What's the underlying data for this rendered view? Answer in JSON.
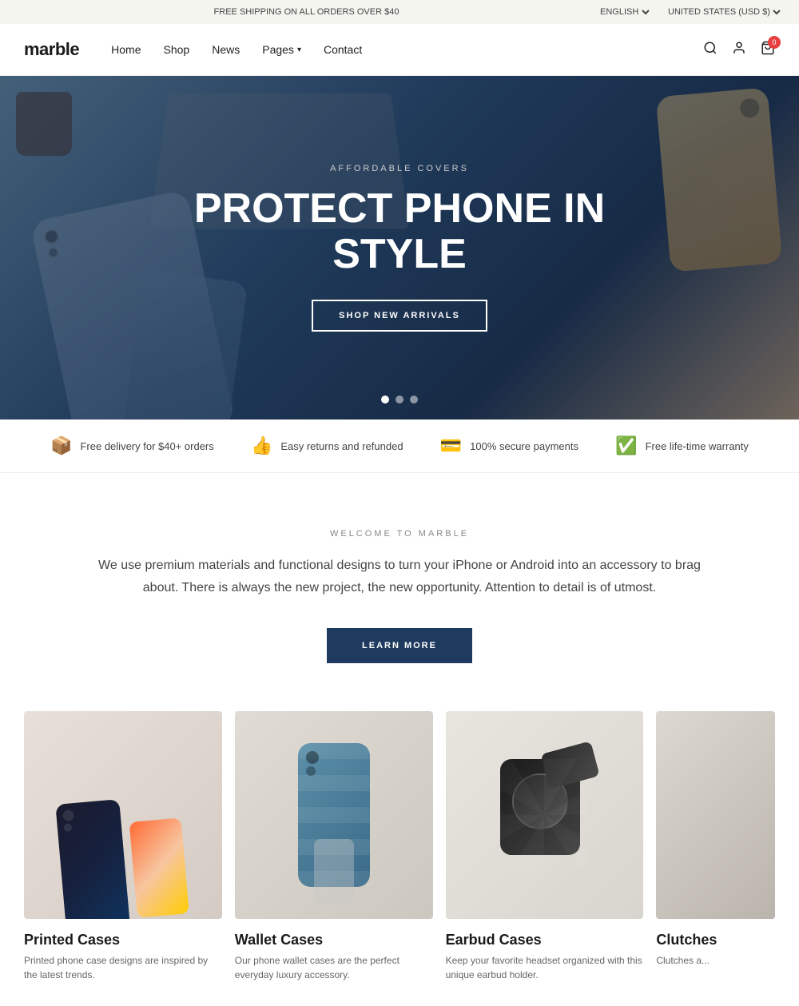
{
  "topbar": {
    "shipping_text": "FREE SHIPPING ON ALL ORDERS OVER $40",
    "language": "ENGLISH",
    "currency": "UNITED STATES (USD $)"
  },
  "navbar": {
    "logo": "marble",
    "links": [
      {
        "label": "Home",
        "id": "home"
      },
      {
        "label": "Shop",
        "id": "shop"
      },
      {
        "label": "News",
        "id": "news"
      },
      {
        "label": "Pages",
        "id": "pages"
      },
      {
        "label": "Contact",
        "id": "contact"
      }
    ],
    "cart_count": "0"
  },
  "hero": {
    "subtitle": "AFFORDABLE COVERS",
    "title": "PROTECT PHONE IN STYLE",
    "cta_label": "SHOP NEW ARRIVALS",
    "dots": [
      {
        "active": true
      },
      {
        "active": false
      },
      {
        "active": false
      }
    ]
  },
  "features": [
    {
      "icon": "📦",
      "text": "Free delivery for $40+ orders"
    },
    {
      "icon": "👍",
      "text": "Easy returns and refunded"
    },
    {
      "icon": "💳",
      "text": "100% secure payments"
    },
    {
      "icon": "✅",
      "text": "Free life-time warranty"
    }
  ],
  "welcome": {
    "label": "WELCOME TO MARBLE",
    "description": "We use premium materials and functional designs to turn your iPhone or Android into an accessory to brag about. There is always the new project, the new opportunity. Attention to detail is of utmost.",
    "cta_label": "LEARN MORE"
  },
  "products": [
    {
      "title": "Printed Cases",
      "description": "Printed phone case designs are inspired by the latest trends.",
      "type": "printed"
    },
    {
      "title": "Wallet Cases",
      "description": "Our phone wallet cases are the perfect everyday luxury accessory.",
      "type": "wallet"
    },
    {
      "title": "Earbud Cases",
      "description": "Keep your favorite headset organized with this unique earbud holder.",
      "type": "earbud"
    },
    {
      "title": "Clutches",
      "description": "Clutches a...",
      "type": "clutch"
    }
  ]
}
